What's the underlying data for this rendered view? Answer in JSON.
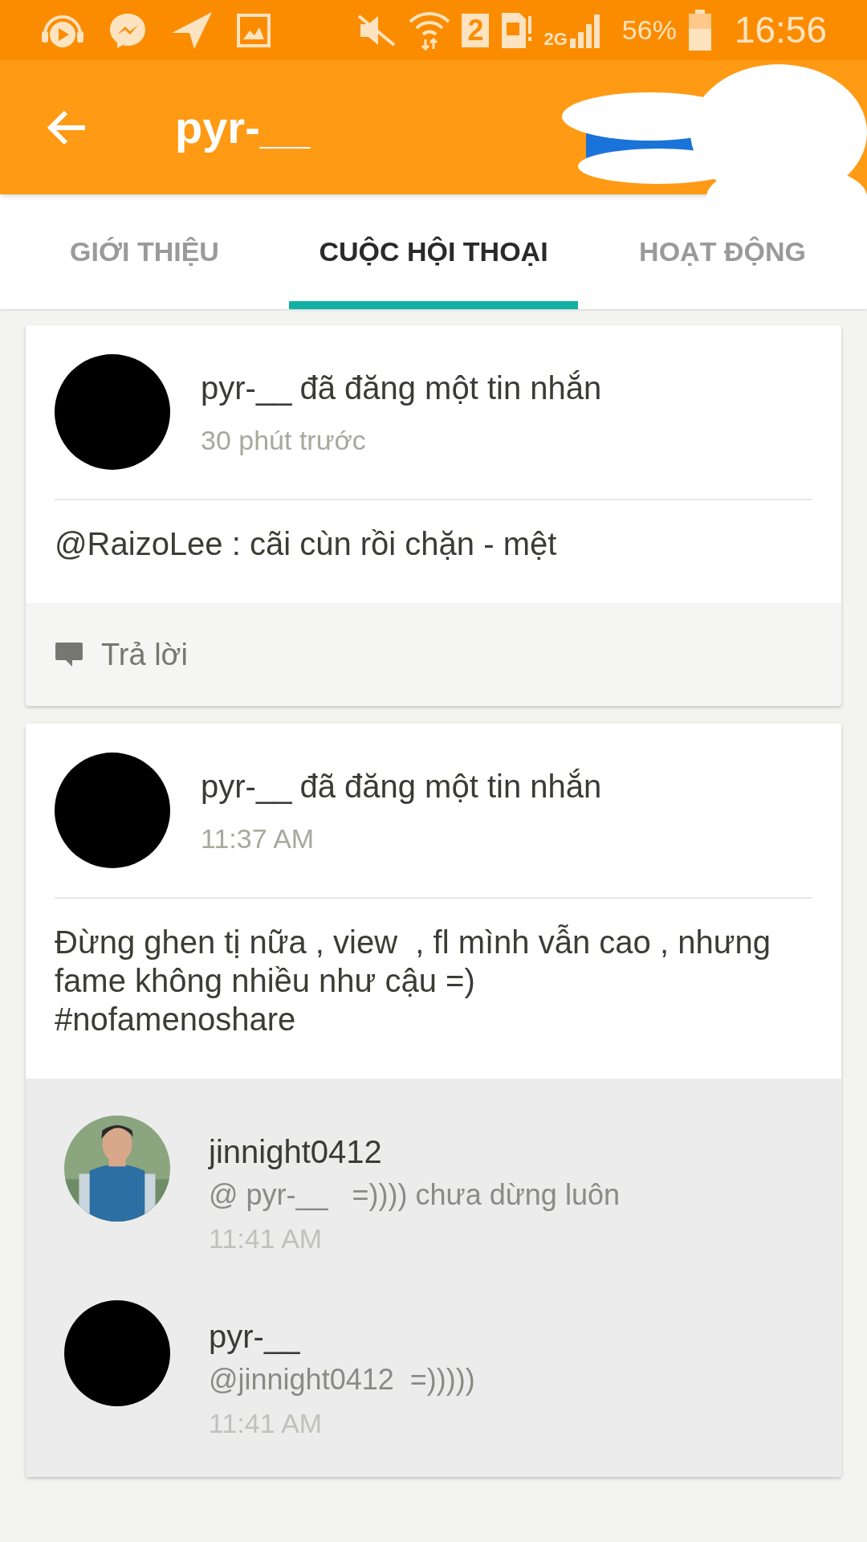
{
  "status_bar": {
    "sim_slot": "2",
    "network": "2G",
    "battery": "56%",
    "time": "16:56"
  },
  "header": {
    "title": "pyr-__"
  },
  "tabs": [
    {
      "label": "GIỚI THIỆU",
      "selected": false
    },
    {
      "label": "CUỘC HỘI THOẠI",
      "selected": true
    },
    {
      "label": "HOẠT ĐỘNG",
      "selected": false
    }
  ],
  "posts": [
    {
      "author": "pyr-__",
      "action": "đã đăng một tin nhắn",
      "time": "30 phút trước",
      "body": "@RaizoLee : cãi cùn rồi chặn - mệt",
      "reply_label": "Trả lời"
    },
    {
      "author": "pyr-__",
      "action": "đã đăng một tin nhắn",
      "time": "11:37 AM",
      "body": "Đừng ghen tị nữa , view  , fl mình vẫn cao , nhưng fame không nhiều như cậu =)\n#nofamenoshare",
      "comments": [
        {
          "author": "jinnight0412",
          "text": "@ pyr-__   =)))) chưa dừng luôn",
          "time": "11:41 AM",
          "kind": "picture"
        },
        {
          "author": "pyr-__",
          "text": "@jinnight0412  =)))))",
          "time": "11:41 AM",
          "kind": "avatar"
        }
      ]
    }
  ]
}
